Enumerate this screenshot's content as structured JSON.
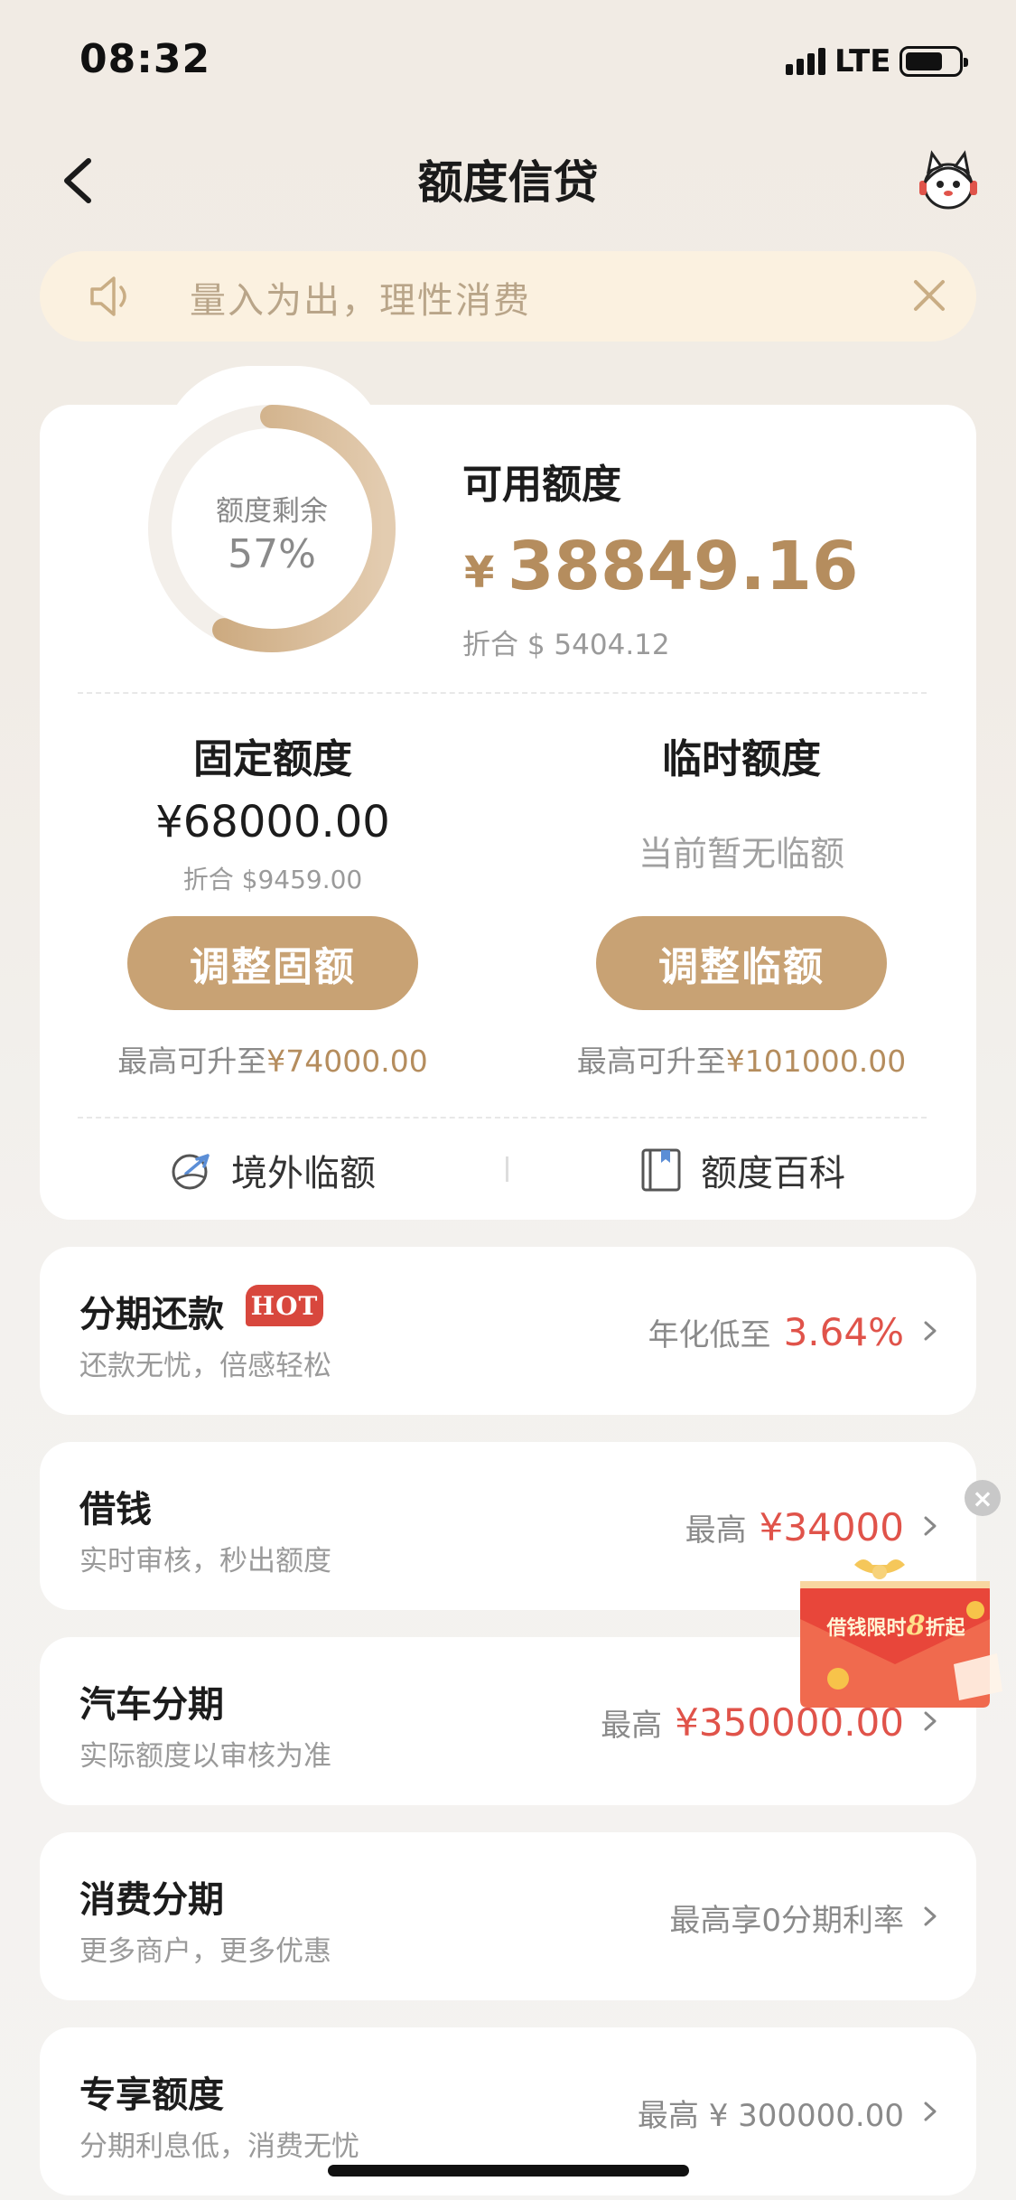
{
  "status_bar": {
    "time": "08:32",
    "network": "LTE"
  },
  "nav": {
    "title": "额度信贷"
  },
  "notice": {
    "text": "量入为出，理性消费"
  },
  "credit": {
    "remaining_label": "额度剩余",
    "remaining_percent": "57%",
    "remaining_fraction": 0.57,
    "available_label": "可用额度",
    "available_currency": "¥",
    "available_amount": "38849.16",
    "available_converted": "折合 $ 5404.12",
    "fixed": {
      "title": "固定额度",
      "amount": "¥68000.00",
      "converted": "折合 $9459.00",
      "button": "调整固额",
      "max_prefix": "最高可升至",
      "max_value": "¥74000.00"
    },
    "temporary": {
      "title": "临时额度",
      "status": "当前暂无临额",
      "button": "调整临额",
      "max_prefix": "最高可升至",
      "max_value": "¥101000.00"
    },
    "tools": [
      {
        "label": "境外临额",
        "icon": "plane-globe-icon"
      },
      {
        "label": "额度百科",
        "icon": "book-icon"
      }
    ]
  },
  "products": [
    {
      "title": "分期还款",
      "badge": "HOT",
      "subtitle": "还款无忧，倍感轻松",
      "right_label": "年化低至",
      "right_value": "3.64%"
    },
    {
      "title": "借钱",
      "subtitle": "实时审核，秒出额度",
      "right_label": "最高",
      "right_value": "¥34000"
    },
    {
      "title": "汽车分期",
      "subtitle": "实际额度以审核为准",
      "right_label": "最高",
      "right_value": "¥350000.00"
    },
    {
      "title": "消费分期",
      "subtitle": "更多商户，更多优惠",
      "right_text": "最高享0分期利率"
    },
    {
      "title": "专享额度",
      "subtitle": "分期利息低，消费无忧",
      "right_text": "最高 ¥ 300000.00"
    }
  ],
  "floating_ad": {
    "text_before": "借钱限时",
    "text_number": "8",
    "text_after": "折起"
  },
  "colors": {
    "accent": "#c8a274",
    "accent_text": "#b58d5e",
    "highlight_red": "#e0534a",
    "notice_bg": "#fbf1e0"
  }
}
